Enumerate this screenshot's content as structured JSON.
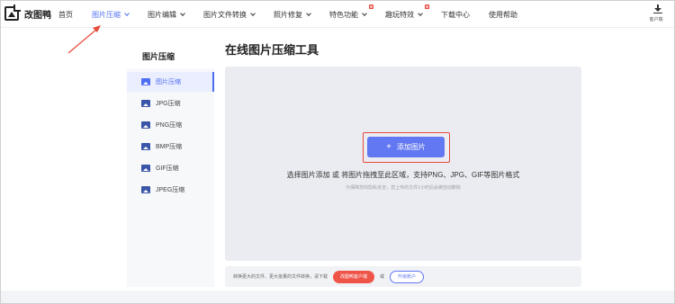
{
  "app": {
    "name": "改图鸭"
  },
  "nav": {
    "items": [
      {
        "label": "首页",
        "active": false,
        "dropdown": false,
        "hot": false
      },
      {
        "label": "图片压缩",
        "active": true,
        "dropdown": true,
        "hot": false
      },
      {
        "label": "图片编辑",
        "active": false,
        "dropdown": true,
        "hot": false
      },
      {
        "label": "图片文件转换",
        "active": false,
        "dropdown": true,
        "hot": false
      },
      {
        "label": "照片修复",
        "active": false,
        "dropdown": true,
        "hot": false
      },
      {
        "label": "特色功能",
        "active": false,
        "dropdown": true,
        "hot": true
      },
      {
        "label": "趣玩特效",
        "active": false,
        "dropdown": true,
        "hot": true
      },
      {
        "label": "下载中心",
        "active": false,
        "dropdown": false,
        "hot": false
      },
      {
        "label": "使用帮助",
        "active": false,
        "dropdown": false,
        "hot": false
      }
    ],
    "client_download_label": "客户端"
  },
  "page": {
    "title": "在线图片压缩工具"
  },
  "sidebar": {
    "title": "图片压缩",
    "items": [
      {
        "label": "图片压缩",
        "active": true,
        "icon": "image-icon"
      },
      {
        "label": "JPG压缩",
        "active": false,
        "icon": "image-icon"
      },
      {
        "label": "PNG压缩",
        "active": false,
        "icon": "image-icon"
      },
      {
        "label": "BMP压缩",
        "active": false,
        "icon": "image-icon"
      },
      {
        "label": "GIF压缩",
        "active": false,
        "icon": "image-icon"
      },
      {
        "label": "JPEG压缩",
        "active": false,
        "icon": "image-icon"
      }
    ]
  },
  "upload": {
    "button_label": "添加图片",
    "hint": "选择图片添加 或 将图片拖拽至此区域，支持PNG、JPG、GIF等图片格式",
    "privacy": "为保障您的隐私安全，您上传的文件1小时后会被自动删除"
  },
  "bottom": {
    "text": "转换更大的文件、更大批量的文件转换，请下载",
    "client_button": "改图鸭客户端",
    "or": "或",
    "upgrade_button": "升级账户"
  },
  "colors": {
    "accent": "#4e6ef2",
    "button": "#6277f2",
    "highlight": "#e8493b",
    "client_button": "#ef5448"
  }
}
